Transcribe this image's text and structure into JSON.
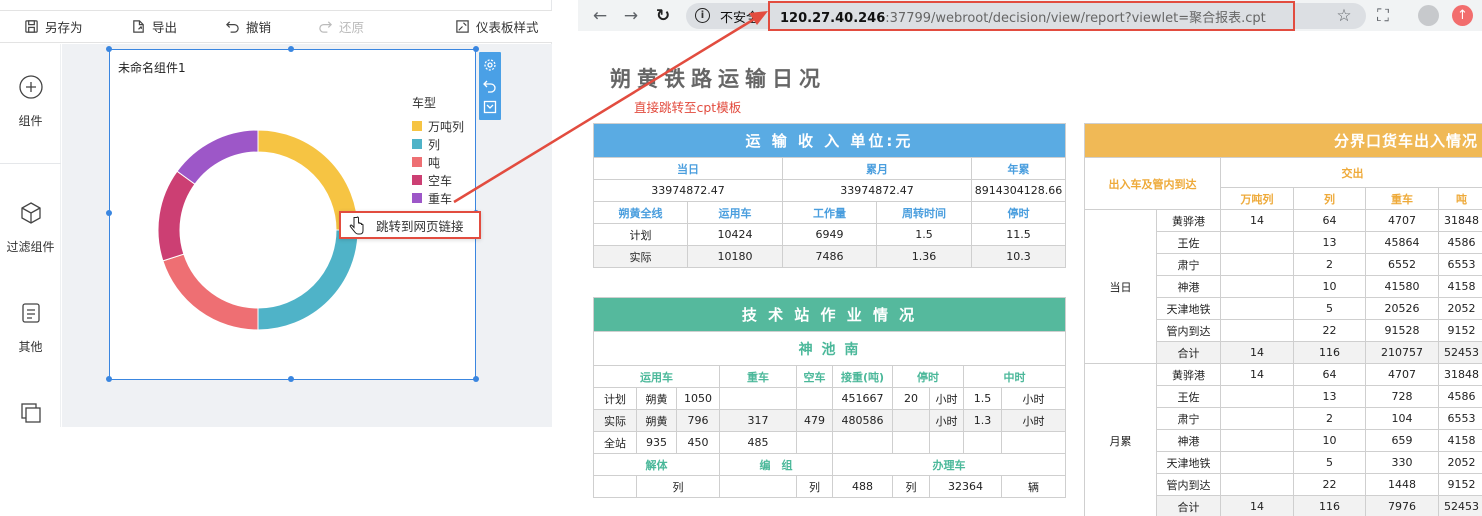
{
  "toolbar": {
    "save_as": "另存为",
    "export": "导出",
    "undo": "撤销",
    "redo": "还原",
    "dashboard_style": "仪表板样式"
  },
  "sidebar": {
    "components": "组件",
    "filter_components": "过滤组件",
    "other": "其他"
  },
  "widget": {
    "title": "未命名组件1",
    "context_menu": "跳转到网页链接"
  },
  "chart_data": {
    "type": "pie",
    "donut": true,
    "legend_title": "车型",
    "legend_position": "right",
    "categories": [
      "万吨列",
      "列",
      "吨",
      "空车",
      "重车"
    ],
    "values": [
      25,
      25,
      20,
      15,
      15
    ],
    "colors": [
      "#f6c443",
      "#4fb3c8",
      "#ee6f73",
      "#cc3f73",
      "#9d57c8"
    ]
  },
  "browser": {
    "insecure_label": "不安全",
    "url_host": "120.27.40.246",
    "url_rest": ":37799/webroot/decision/view/report?viewlet=聚合报表.cpt"
  },
  "report": {
    "title": "朔黄铁路运输日况",
    "note": "直接跳转至cpt模板",
    "income": {
      "band": "运 输 收 入 单位:元",
      "h1": [
        "当日",
        "累月",
        "年累"
      ],
      "v1": [
        "33974872.47",
        "33974872.47",
        "8914304128.66"
      ],
      "h2": [
        "朔黄全线",
        "运用车",
        "工作量",
        "周转时间",
        "停时"
      ],
      "rows": [
        [
          "计划",
          "10424",
          "6949",
          "1.5",
          "11.5"
        ],
        [
          "实际",
          "10180",
          "7486",
          "1.36",
          "10.3"
        ]
      ]
    },
    "tech": {
      "band": "技 术 站 作 业 情 况",
      "station": "神 池 南",
      "h": [
        "运用车",
        "重车",
        "空车",
        "接重(吨)",
        "停时",
        "中时"
      ],
      "rows": [
        [
          "计划",
          "朔黄",
          "1050",
          "",
          "",
          "451667",
          "20",
          "小时",
          "1.5",
          "小时"
        ],
        [
          "实际",
          "朔黄",
          "796",
          "317",
          "479",
          "480586",
          "",
          "小时",
          "1.3",
          "小时"
        ],
        [
          "全站",
          "935",
          "450",
          "485",
          "",
          "",
          "",
          "",
          "",
          ""
        ]
      ],
      "h2": [
        "解体",
        "编　组",
        "办理车"
      ],
      "r2": [
        "",
        "列",
        "",
        "列",
        "488",
        "列",
        "32364",
        "辆"
      ]
    },
    "border": {
      "band": "分界口货车出入情况",
      "h_left": "出入车及管内到达",
      "h_group": "交出",
      "cols": [
        "万吨列",
        "列",
        "重车",
        "吨"
      ],
      "g1": "当日",
      "g2": "月累",
      "rows1": [
        [
          "黄骅港",
          "14",
          "64",
          "4707",
          "31848"
        ],
        [
          "王佐",
          "",
          "13",
          "45864",
          "4586"
        ],
        [
          "肃宁",
          "",
          "2",
          "6552",
          "6553"
        ],
        [
          "神港",
          "",
          "10",
          "41580",
          "4158"
        ],
        [
          "天津地铁",
          "",
          "5",
          "20526",
          "2052"
        ],
        [
          "管内到达",
          "",
          "22",
          "91528",
          "9152"
        ],
        [
          "合计",
          "14",
          "116",
          "210757",
          "52453"
        ]
      ],
      "rows2": [
        [
          "黄骅港",
          "14",
          "64",
          "4707",
          "31848"
        ],
        [
          "王佐",
          "",
          "13",
          "728",
          "4586"
        ],
        [
          "肃宁",
          "",
          "2",
          "104",
          "6553"
        ],
        [
          "神港",
          "",
          "10",
          "659",
          "4158"
        ],
        [
          "天津地铁",
          "",
          "5",
          "330",
          "2052"
        ],
        [
          "管内到达",
          "",
          "22",
          "1448",
          "9152"
        ],
        [
          "合计",
          "14",
          "116",
          "7976",
          "52453"
        ]
      ]
    }
  }
}
